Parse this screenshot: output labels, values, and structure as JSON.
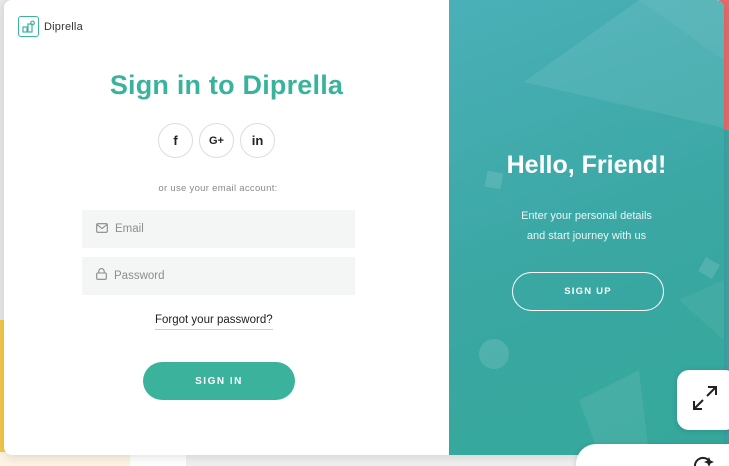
{
  "brand": {
    "name": "Diprella"
  },
  "signin": {
    "title": "Sign in to Diprella",
    "social_buttons": [
      {
        "label": "f",
        "icon": "facebook-icon"
      },
      {
        "label": "G+",
        "icon": "google-plus-icon"
      },
      {
        "label": "in",
        "icon": "linkedin-icon"
      }
    ],
    "divider_text": "or use your email account:",
    "email_placeholder": "Email",
    "password_placeholder": "Password",
    "forgot_label": "Forgot your password?",
    "submit_label": "SIGN IN"
  },
  "welcome": {
    "heading": "Hello, Friend!",
    "line1": "Enter your personal details",
    "line2": "and start journey with us",
    "signup_label": "SIGN UP"
  },
  "colors": {
    "accent": "#3bb39c",
    "panel_gradient_start": "#4ab0b8",
    "panel_gradient_end": "#35a89a"
  }
}
